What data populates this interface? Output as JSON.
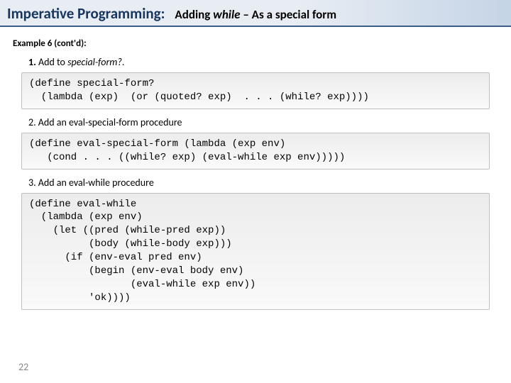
{
  "title": {
    "left": "Imperative Programming:",
    "right_pre": "Adding ",
    "right_em": "while",
    "right_post": " – As a special form"
  },
  "example_label": "Example 6 (cont'd):",
  "steps": [
    {
      "num": "1.",
      "text_pre": " Add to ",
      "text_em": "special-form?",
      "text_post": ".",
      "code": "(define special-form?\n  (lambda (exp)  (or (quoted? exp)  . . . (while? exp))))"
    },
    {
      "num": "2.",
      "text_pre": " Add an eval-special-form procedure",
      "text_em": "",
      "text_post": "",
      "code": "(define eval-special-form (lambda (exp env)\n   (cond . . . ((while? exp) (eval-while exp env)))))"
    },
    {
      "num": "3.",
      "text_pre": " Add an eval-while procedure",
      "text_em": "",
      "text_post": "",
      "code": "(define eval-while\n  (lambda (exp env)\n    (let ((pred (while-pred exp))\n          (body (while-body exp)))\n      (if (env-eval pred env)\n          (begin (env-eval body env)\n                 (eval-while exp env))\n          'ok))))"
    }
  ],
  "page_number": "22"
}
